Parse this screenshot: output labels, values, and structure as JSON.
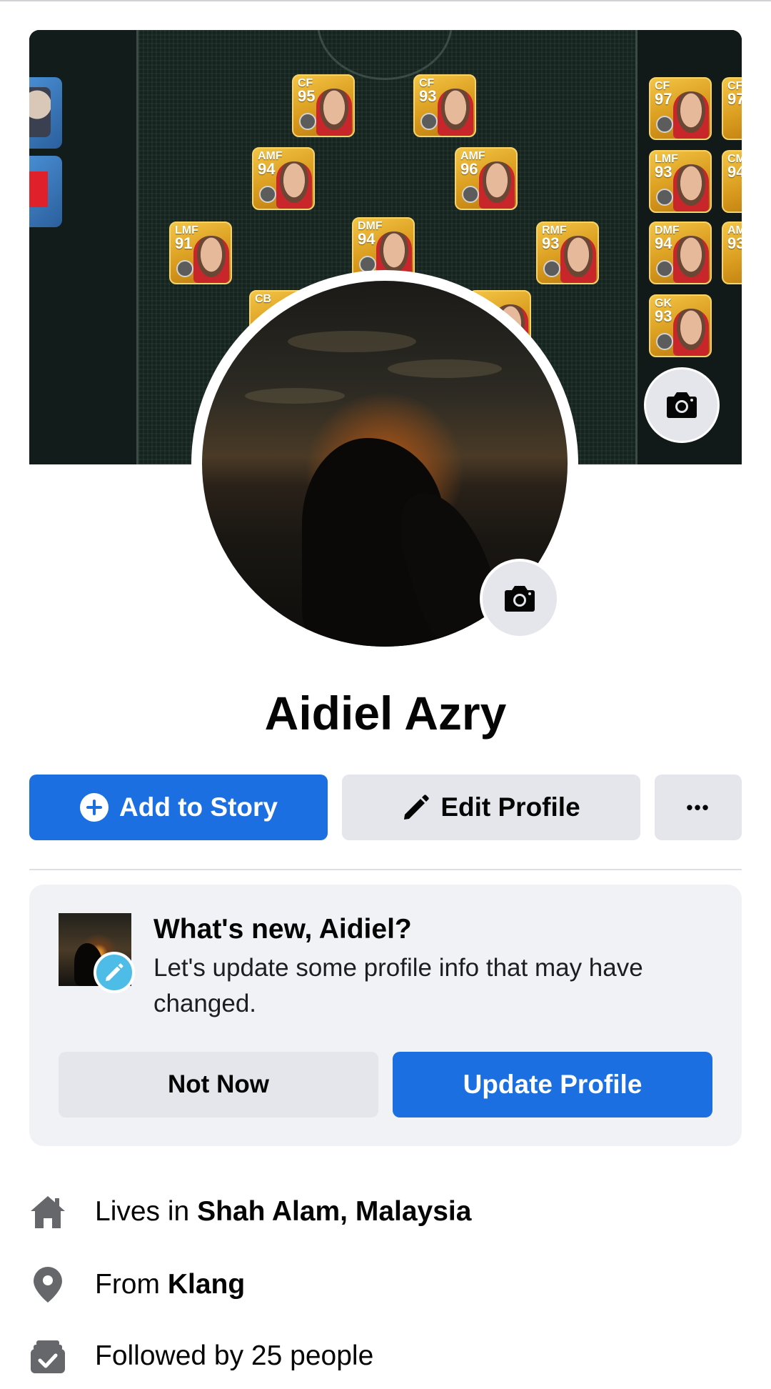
{
  "profile": {
    "name": "Aidiel Azry"
  },
  "cover_cards": [
    {
      "pos": "CF",
      "rating": "95"
    },
    {
      "pos": "CF",
      "rating": "93"
    },
    {
      "pos": "AMF",
      "rating": "94"
    },
    {
      "pos": "AMF",
      "rating": "96"
    },
    {
      "pos": "LMF",
      "rating": "91"
    },
    {
      "pos": "DMF",
      "rating": "94"
    },
    {
      "pos": "RMF",
      "rating": "93"
    },
    {
      "pos": "CB",
      "rating": ""
    },
    {
      "pos": "CF",
      "rating": "97"
    },
    {
      "pos": "LMF",
      "rating": "93"
    },
    {
      "pos": "DMF",
      "rating": "94"
    },
    {
      "pos": "GK",
      "rating": "93"
    },
    {
      "pos": "CF",
      "rating": "97"
    },
    {
      "pos": "CM",
      "rating": "94"
    },
    {
      "pos": "AM",
      "rating": "93"
    }
  ],
  "actions": {
    "add_story": "Add to Story",
    "edit_profile": "Edit Profile",
    "more": "•••"
  },
  "prompt": {
    "title": "What's new, Aidiel?",
    "text": "Let's update some profile info that may have changed.",
    "not_now": "Not Now",
    "update": "Update Profile"
  },
  "details": {
    "lives_prefix": "Lives in ",
    "lives_value": "Shah Alam, Malaysia",
    "from_prefix": "From ",
    "from_value": "Klang",
    "followed": "Followed by 25 people"
  },
  "icons": {
    "cover_camera": "camera-icon",
    "avatar_camera": "camera-icon",
    "add_story": "plus-circle-icon",
    "edit": "pencil-icon",
    "home": "home-icon",
    "location": "location-pin-icon",
    "followers": "followers-icon"
  },
  "colors": {
    "primary": "#1b6fe0",
    "secondary_button": "#e4e6eb",
    "card_bg": "#f1f2f5",
    "icon_gray": "#65676b",
    "pencil_badge": "#4dbde8"
  }
}
